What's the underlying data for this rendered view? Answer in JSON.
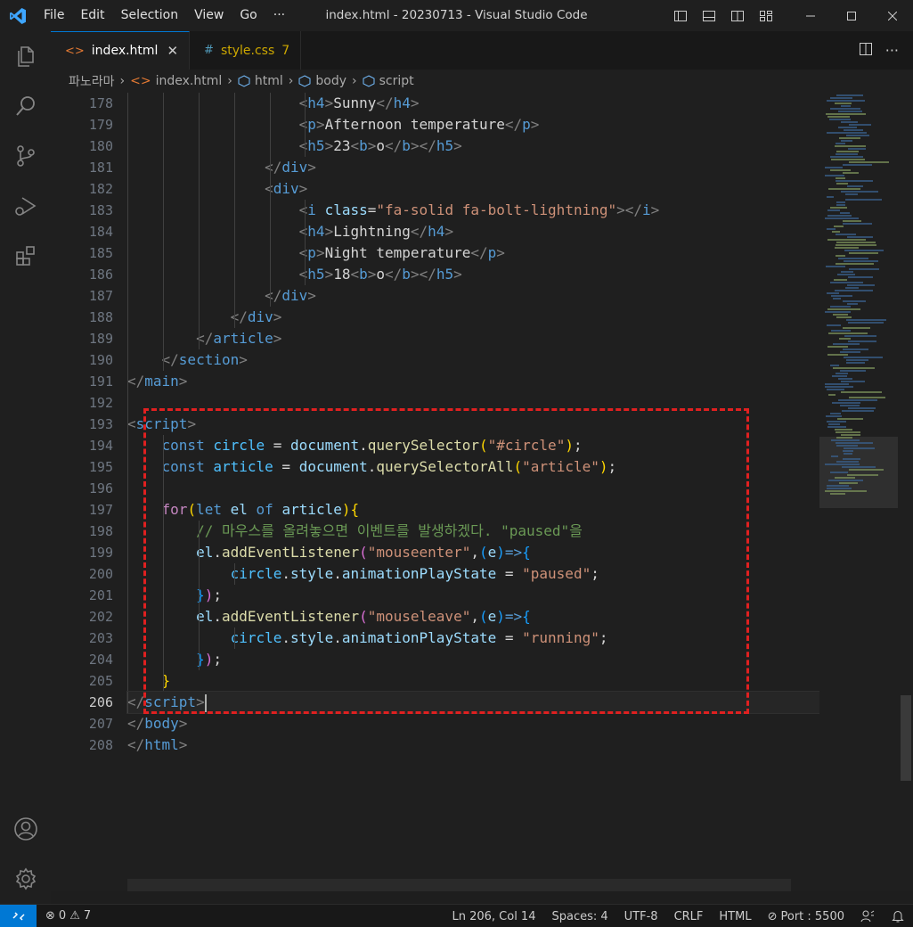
{
  "titlebar": {
    "menu": [
      "File",
      "Edit",
      "Selection",
      "View",
      "Go",
      "···"
    ],
    "title": "index.html - 20230713 - Visual Studio Code"
  },
  "tabs": [
    {
      "label": "index.html",
      "icon": "html-file-icon",
      "active": true
    },
    {
      "label": "style.css",
      "icon": "css-file-icon",
      "badge": "7",
      "active": false
    }
  ],
  "breadcrumb": [
    "파노라마",
    "index.html",
    "html",
    "body",
    "script"
  ],
  "editor": {
    "line_numbers": [
      "178",
      "179",
      "180",
      "181",
      "182",
      "183",
      "184",
      "185",
      "186",
      "187",
      "188",
      "189",
      "190",
      "191",
      "192",
      "193",
      "194",
      "195",
      "196",
      "197",
      "198",
      "199",
      "200",
      "201",
      "202",
      "203",
      "204",
      "205",
      "206",
      "207",
      "208"
    ],
    "current_line": "206",
    "code": {
      "l178": {
        "open": "h4",
        "text": "Sunny"
      },
      "l179": {
        "open": "p",
        "text": "Afternoon temperature"
      },
      "l180": {
        "open": "h5",
        "text": "23",
        "inner": "b",
        "inner_text": "o"
      },
      "l181": {
        "close": "div"
      },
      "l182": {
        "open": "div"
      },
      "l183": {
        "tag": "i",
        "attr": "class",
        "value": "\"fa-solid fa-bolt-lightning\""
      },
      "l184": {
        "open": "h4",
        "text": "Lightning"
      },
      "l185": {
        "open": "p",
        "text": "Night temperature"
      },
      "l186": {
        "open": "h5",
        "text": "18",
        "inner": "b",
        "inner_text": "o"
      },
      "l187": {
        "close": "div"
      },
      "l188": {
        "close": "div"
      },
      "l189": {
        "close": "article"
      },
      "l190": {
        "close": "section"
      },
      "l191": {
        "close": "main"
      },
      "l193": {
        "open": "script"
      },
      "l194": {
        "kw": "const",
        "var": "circle",
        "obj": "document",
        "fn": "querySelector",
        "arg": "\"#circle\""
      },
      "l195": {
        "kw": "const",
        "var": "article",
        "obj": "document",
        "fn": "querySelectorAll",
        "arg": "\"article\""
      },
      "l197": {
        "kw": "for",
        "let": "let",
        "var": "el",
        "of": "of",
        "iter": "article"
      },
      "l198": {
        "comment": "// 마우스를 올려놓으면 이벤트를 발생하겠다. \"paused\"을"
      },
      "l199": {
        "obj": "el",
        "fn": "addEventListener",
        "arg": "\"mouseenter\"",
        "param": "e"
      },
      "l200": {
        "obj": "circle",
        "prop1": "style",
        "prop2": "animationPlayState",
        "value": "\"paused\""
      },
      "l202": {
        "obj": "el",
        "fn": "addEventListener",
        "arg": "\"mouseleave\"",
        "param": "e"
      },
      "l203": {
        "obj": "circle",
        "prop1": "style",
        "prop2": "animationPlayState",
        "value": "\"running\""
      },
      "l206": {
        "close": "script"
      },
      "l207": {
        "close": "body"
      },
      "l208": {
        "close": "html"
      }
    }
  },
  "statusbar": {
    "errors": "0",
    "warnings": "7",
    "position": "Ln 206, Col 14",
    "spaces": "Spaces: 4",
    "encoding": "UTF-8",
    "eol": "CRLF",
    "language": "HTML",
    "port": "Port : 5500"
  },
  "colors": {
    "accent": "#0078d4",
    "annotation_box": "#e02020",
    "warning": "#cca700"
  }
}
